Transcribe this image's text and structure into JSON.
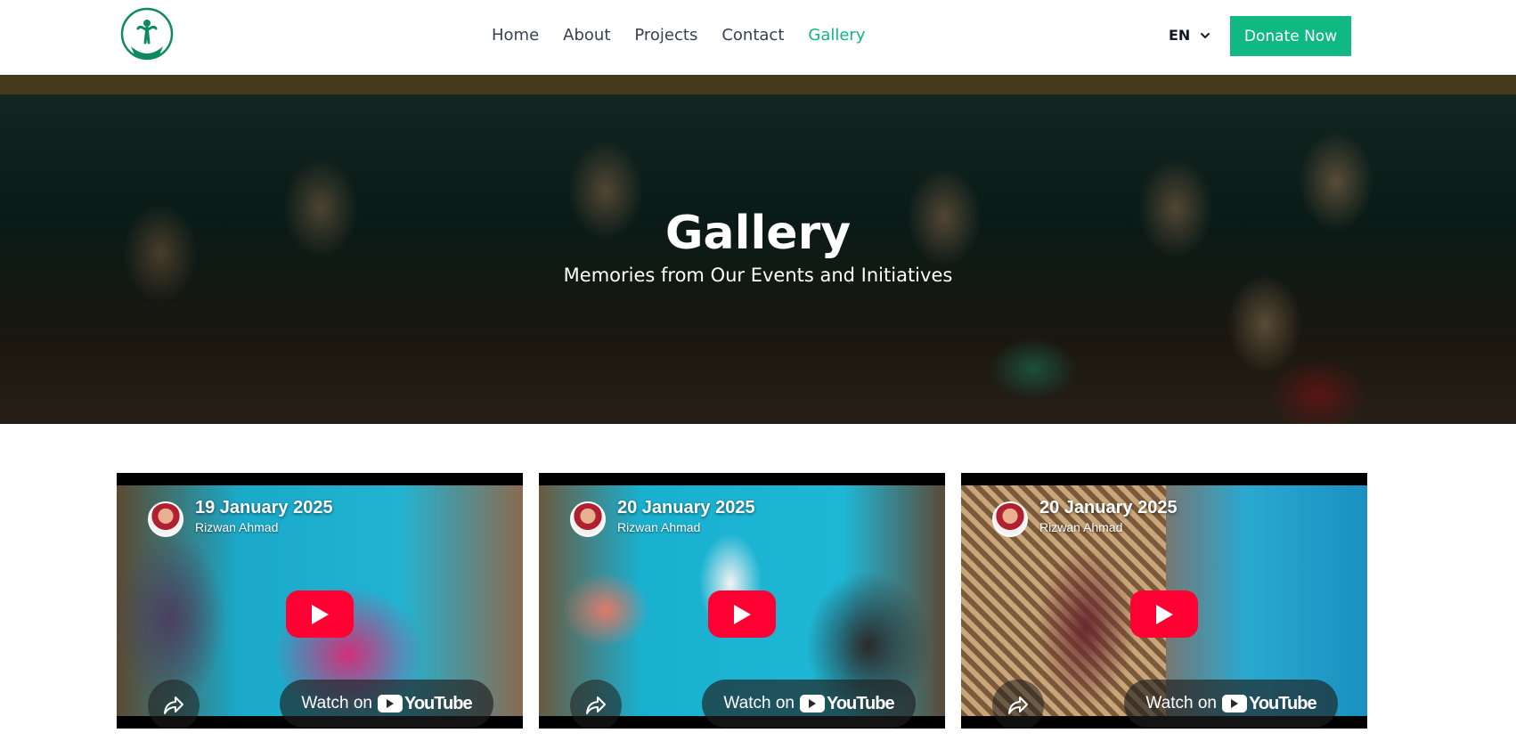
{
  "header": {
    "logo_alt": "Humanity Care Foundation",
    "nav": [
      {
        "label": "Home"
      },
      {
        "label": "About"
      },
      {
        "label": "Projects"
      },
      {
        "label": "Contact"
      },
      {
        "label": "Gallery",
        "active": true
      }
    ],
    "language": "EN",
    "donate_label": "Donate Now"
  },
  "hero": {
    "title": "Gallery",
    "subtitle": "Memories from Our Events and Initiatives"
  },
  "videos": [
    {
      "title": "19 January 2025",
      "channel": "Rizwan Ahmad",
      "watch_label": "Watch on",
      "platform": "YouTube"
    },
    {
      "title": "20 January 2025",
      "channel": "Rizwan Ahmad",
      "watch_label": "Watch on",
      "platform": "YouTube"
    },
    {
      "title": "20 January 2025",
      "channel": "Rizwan Ahmad",
      "watch_label": "Watch on",
      "platform": "YouTube"
    }
  ],
  "colors": {
    "accent": "#10b981",
    "youtube_red": "#ff0033"
  }
}
